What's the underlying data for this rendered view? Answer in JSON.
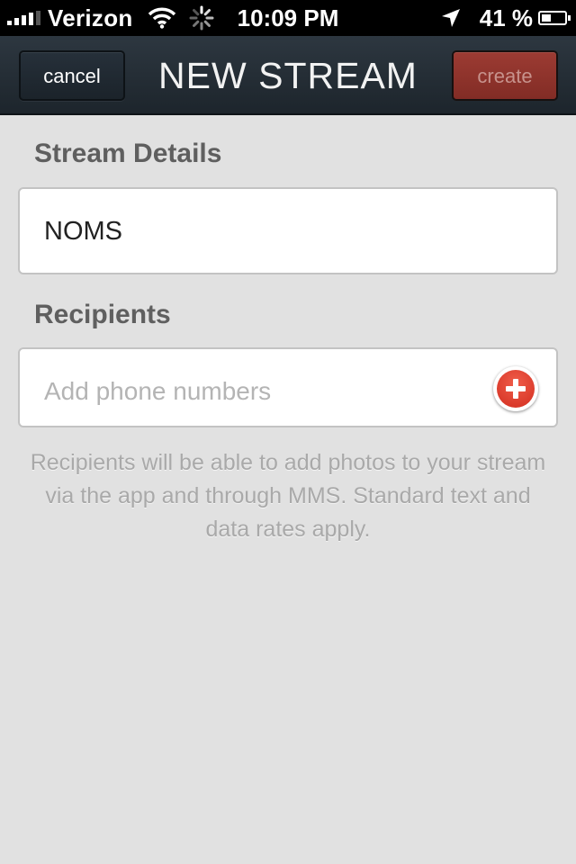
{
  "status_bar": {
    "carrier": "Verizon",
    "time": "10:09 PM",
    "battery_percent": "41 %",
    "battery_level": 0.41,
    "icons": [
      "signal-bars-icon",
      "wifi-icon",
      "activity-spinner-icon",
      "location-arrow-icon",
      "battery-icon"
    ]
  },
  "nav": {
    "title": "NEW STREAM",
    "cancel_label": "cancel",
    "create_label": "create"
  },
  "stream_details": {
    "heading": "Stream Details",
    "name_value": "NOMS"
  },
  "recipients": {
    "heading": "Recipients",
    "placeholder": "Add phone numbers",
    "add_icon": "add-circle-icon",
    "help_text": "Recipients will be able to add photos to your stream via the app and through MMS. Standard text and data rates apply."
  },
  "colors": {
    "nav_background": "#232d35",
    "create_button": "#8f332c",
    "page_background": "#e1e1e1",
    "add_button": "#e0402f"
  }
}
